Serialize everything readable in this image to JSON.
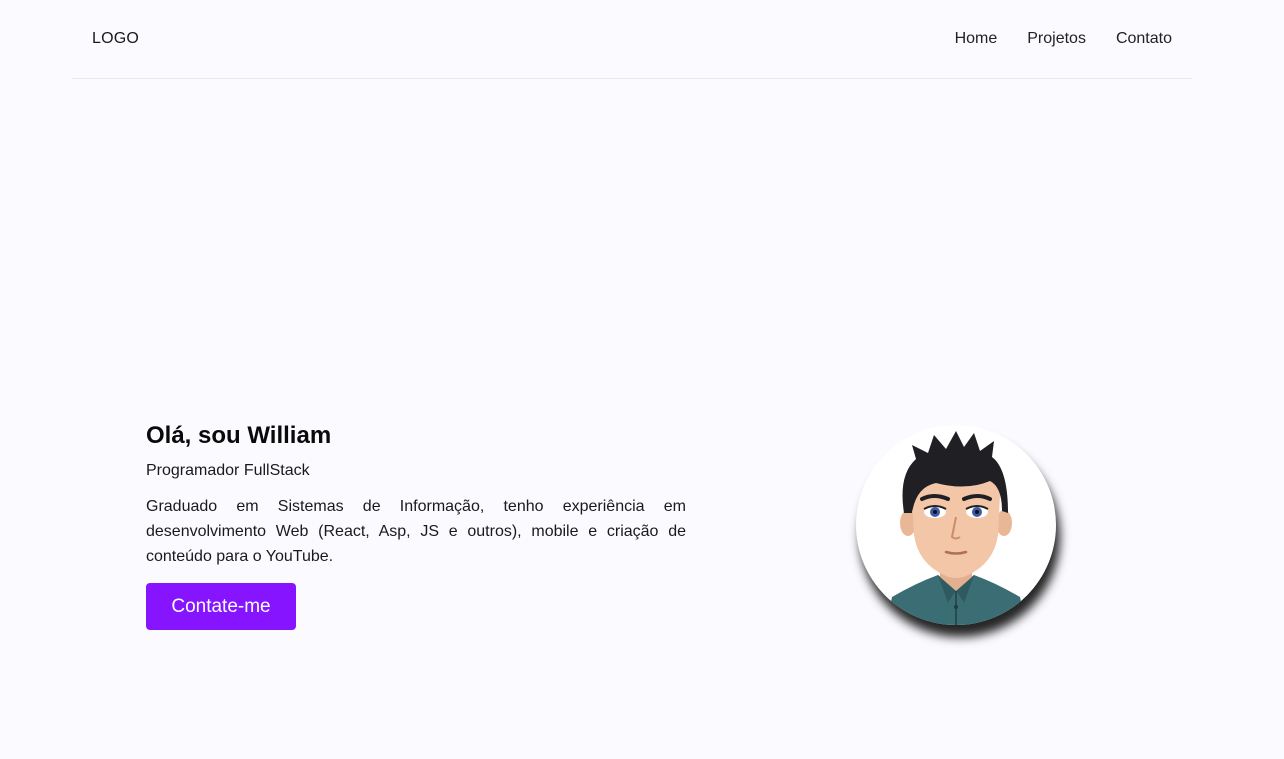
{
  "navbar": {
    "logo": "LOGO",
    "links": [
      "Home",
      "Projetos",
      "Contato"
    ]
  },
  "hero": {
    "title": "Olá, sou William",
    "subtitle": "Programador FullStack",
    "description": "Graduado em Sistemas de Informação, tenho experiência em desenvolvimento Web (React, Asp, JS e outros), mobile e criação de conteúdo para o YouTube.",
    "button_label": "Contate-me"
  },
  "colors": {
    "background": "#fbfaff",
    "accent": "#8614ff"
  },
  "avatar": {
    "icon": "cartoon-avatar"
  }
}
